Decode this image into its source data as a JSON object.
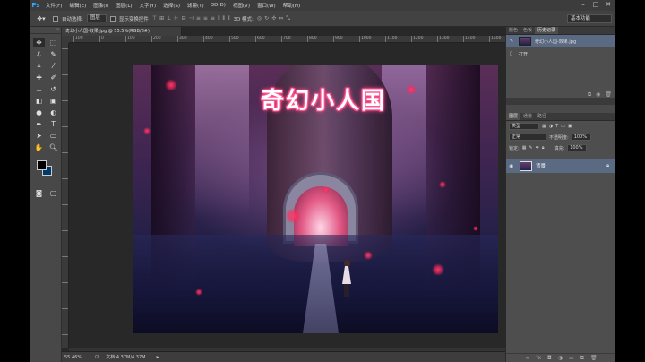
{
  "app": {
    "logo": "Ps"
  },
  "menu": [
    "文件(F)",
    "编辑(E)",
    "图像(I)",
    "图层(L)",
    "文字(Y)",
    "选择(S)",
    "滤镜(T)",
    "3D(D)",
    "视图(V)",
    "窗口(W)",
    "帮助(H)"
  ],
  "window_controls": {
    "minimize": "–",
    "maximize": "□",
    "close": "✕"
  },
  "options": {
    "auto_select_label": "自动选择:",
    "auto_select_value": "图层",
    "transform_label": "显示变换控件",
    "mode_3d_label": "3D 模式:",
    "workspace": "基本功能"
  },
  "document": {
    "tab_title": "奇幻小人国-效果.jpg @ 55.5%(RGB/8#)",
    "ruler_ticks": [
      "100",
      "0",
      "100",
      "200",
      "300",
      "400",
      "500",
      "600",
      "700",
      "800",
      "900",
      "1000",
      "1100",
      "1200",
      "1300",
      "1400",
      "1500"
    ],
    "canvas_title": "奇幻小人国"
  },
  "status": {
    "zoom": "55.46%",
    "doc_info": "文档:4.37M/4.37M"
  },
  "history_panel": {
    "tabs": [
      "颜色",
      "色板",
      "历史记录"
    ],
    "active_tab": 2,
    "snapshot_label": "奇幻小人国-效果.jpg",
    "step_label": "打开"
  },
  "layers_panel": {
    "tabs": [
      "图层",
      "通道",
      "路径"
    ],
    "active_tab": 0,
    "kind_label": "类型",
    "blend_mode": "正常",
    "opacity_label": "不透明度:",
    "opacity_value": "100%",
    "lock_label": "锁定:",
    "fill_label": "填充:",
    "fill_value": "100%",
    "layer_name": "背景"
  },
  "colors": {
    "foreground": "#000000",
    "background": "#003a6b",
    "accent_selection": "#5a6a82",
    "title_glow": "#ff5c95"
  }
}
